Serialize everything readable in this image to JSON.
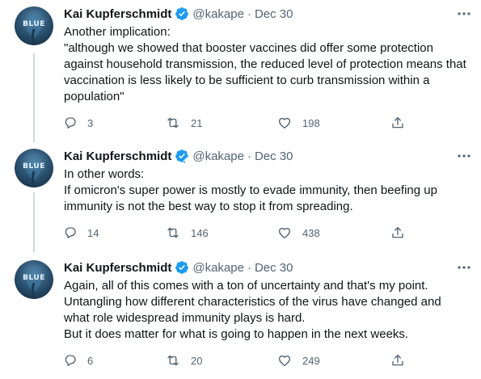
{
  "tweets": [
    {
      "name": "Kai Kupferschmidt",
      "handle": "@kakape",
      "separator": "·",
      "date": "Dec 30",
      "avatar_text": "BLUE",
      "lines": [
        "Another implication:",
        "\"although we showed that booster vaccines did offer some protection",
        "against household transmission, the reduced level of protection means that",
        "vaccination is less likely to be sufficient to curb transmission within a",
        "population\""
      ],
      "replies": "3",
      "retweets": "21",
      "likes": "198"
    },
    {
      "name": "Kai Kupferschmidt",
      "handle": "@kakape",
      "separator": "·",
      "date": "Dec 30",
      "avatar_text": "BLUE",
      "lines": [
        "In other words:",
        "If omicron's super power is mostly to evade immunity, then beefing up",
        "immunity is not the best way to stop it from spreading."
      ],
      "replies": "14",
      "retweets": "146",
      "likes": "438"
    },
    {
      "name": "Kai Kupferschmidt",
      "handle": "@kakape",
      "separator": "·",
      "date": "Dec 30",
      "avatar_text": "BLUE",
      "lines": [
        "Again, all of this comes with a ton of uncertainty and that's my point.",
        "Untangling how different characteristics of the virus have changed and",
        "what role widespread immunity plays is hard.",
        "But it does matter for what is going to happen in the next weeks."
      ],
      "replies": "6",
      "retweets": "20",
      "likes": "249"
    }
  ],
  "icons": {
    "verified": "verified-badge-icon",
    "more": "more-options-icon",
    "reply": "reply-icon",
    "retweet": "retweet-icon",
    "like": "like-icon",
    "share": "share-icon"
  },
  "colors": {
    "verified": "#1d9bf0",
    "muted": "#536471",
    "text": "#0f1419",
    "thread_line": "#cfd9de"
  }
}
